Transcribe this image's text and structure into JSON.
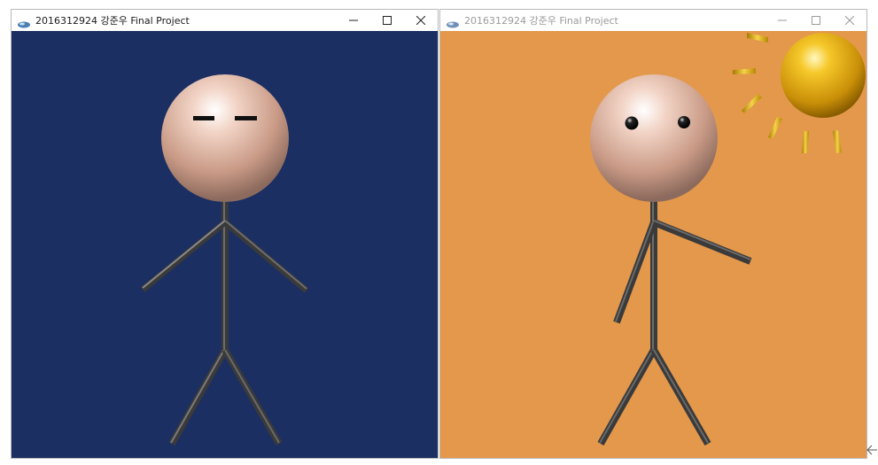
{
  "windows": [
    {
      "title": "2016312924 강준우 Final Project",
      "state": "active",
      "scene_background": "#1b2f62",
      "eyes": "closed"
    },
    {
      "title": "2016312924 강준우 Final Project",
      "state": "inactive",
      "scene_background": "#e3984b",
      "eyes": "open",
      "has_sun": true
    }
  ],
  "controls": {
    "minimize": "minimize-icon",
    "maximize": "maximize-icon",
    "close": "close-icon"
  },
  "colors": {
    "head": "#e8c2b0",
    "body": "#3a3a3a",
    "sun": "#e8b010",
    "left_background": "#1b2f62",
    "right_background": "#e3984b"
  }
}
